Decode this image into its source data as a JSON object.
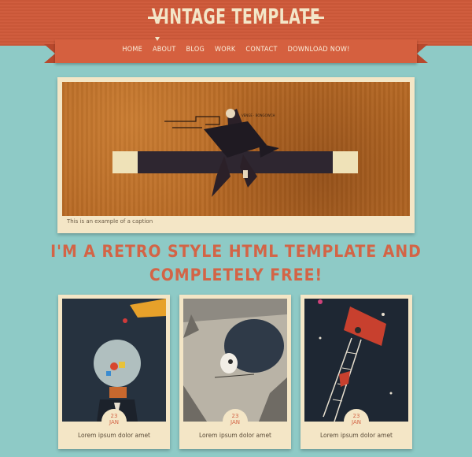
{
  "header": {
    "logo": "VINTAGE TEMPLATE",
    "nav": [
      "HOME",
      "ABOUT",
      "BLOG",
      "WORK",
      "CONTACT",
      "DOWNLOAD NOW!"
    ]
  },
  "hero": {
    "caption": "This is an example of a caption"
  },
  "headline": {
    "line1": "I'M A RETRO STYLE HTML TEMPLATE AND",
    "line2": "COMPLETELY FREE!"
  },
  "cards": [
    {
      "day": "23",
      "month": "JAN",
      "text": "Lorem ipsum dolor amet"
    },
    {
      "day": "23",
      "month": "JAN",
      "text": "Lorem ipsum dolor amet"
    },
    {
      "day": "23",
      "month": "JAN",
      "text": "Lorem ipsum dolor amet"
    }
  ],
  "colors": {
    "background": "#8ecac6",
    "header": "#cf5a3a",
    "accent": "#d36446",
    "paper": "#f4e6c6"
  }
}
